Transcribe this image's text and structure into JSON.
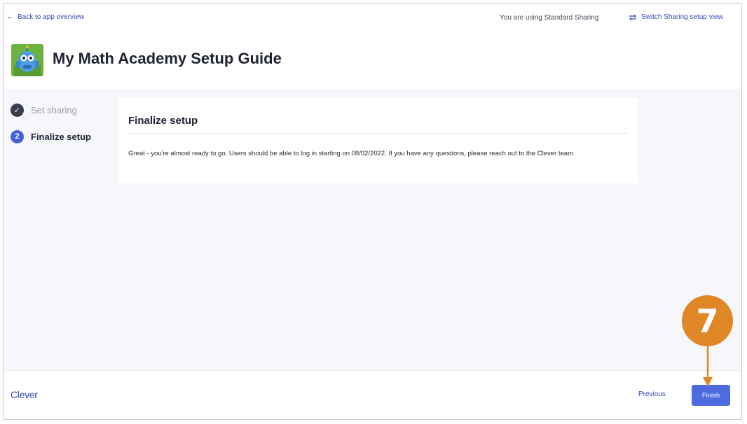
{
  "header": {
    "back_label": "Back to app overview",
    "sharing_status": "You are using Standard Sharing",
    "switch_label": "Switch Sharing setup view",
    "app_title": "My Math Academy Setup Guide"
  },
  "steps": [
    {
      "number": "✓",
      "label": "Set sharing",
      "state": "completed"
    },
    {
      "number": "2",
      "label": "Finalize setup",
      "state": "active"
    }
  ],
  "card": {
    "title": "Finalize setup",
    "body": "Great - you're almost ready to go. Users should be able to log in starting on 08/02/2022. If you have any questions, please reach out to the Clever team."
  },
  "footer": {
    "brand": "Clever",
    "previous_label": "Previous",
    "finish_label": "Finish"
  },
  "annotation": {
    "callout_number": "7"
  },
  "colors": {
    "accent": "#4f6be0",
    "link": "#3b4ab8",
    "callout": "#df8727",
    "background": "#f6f7fa"
  }
}
